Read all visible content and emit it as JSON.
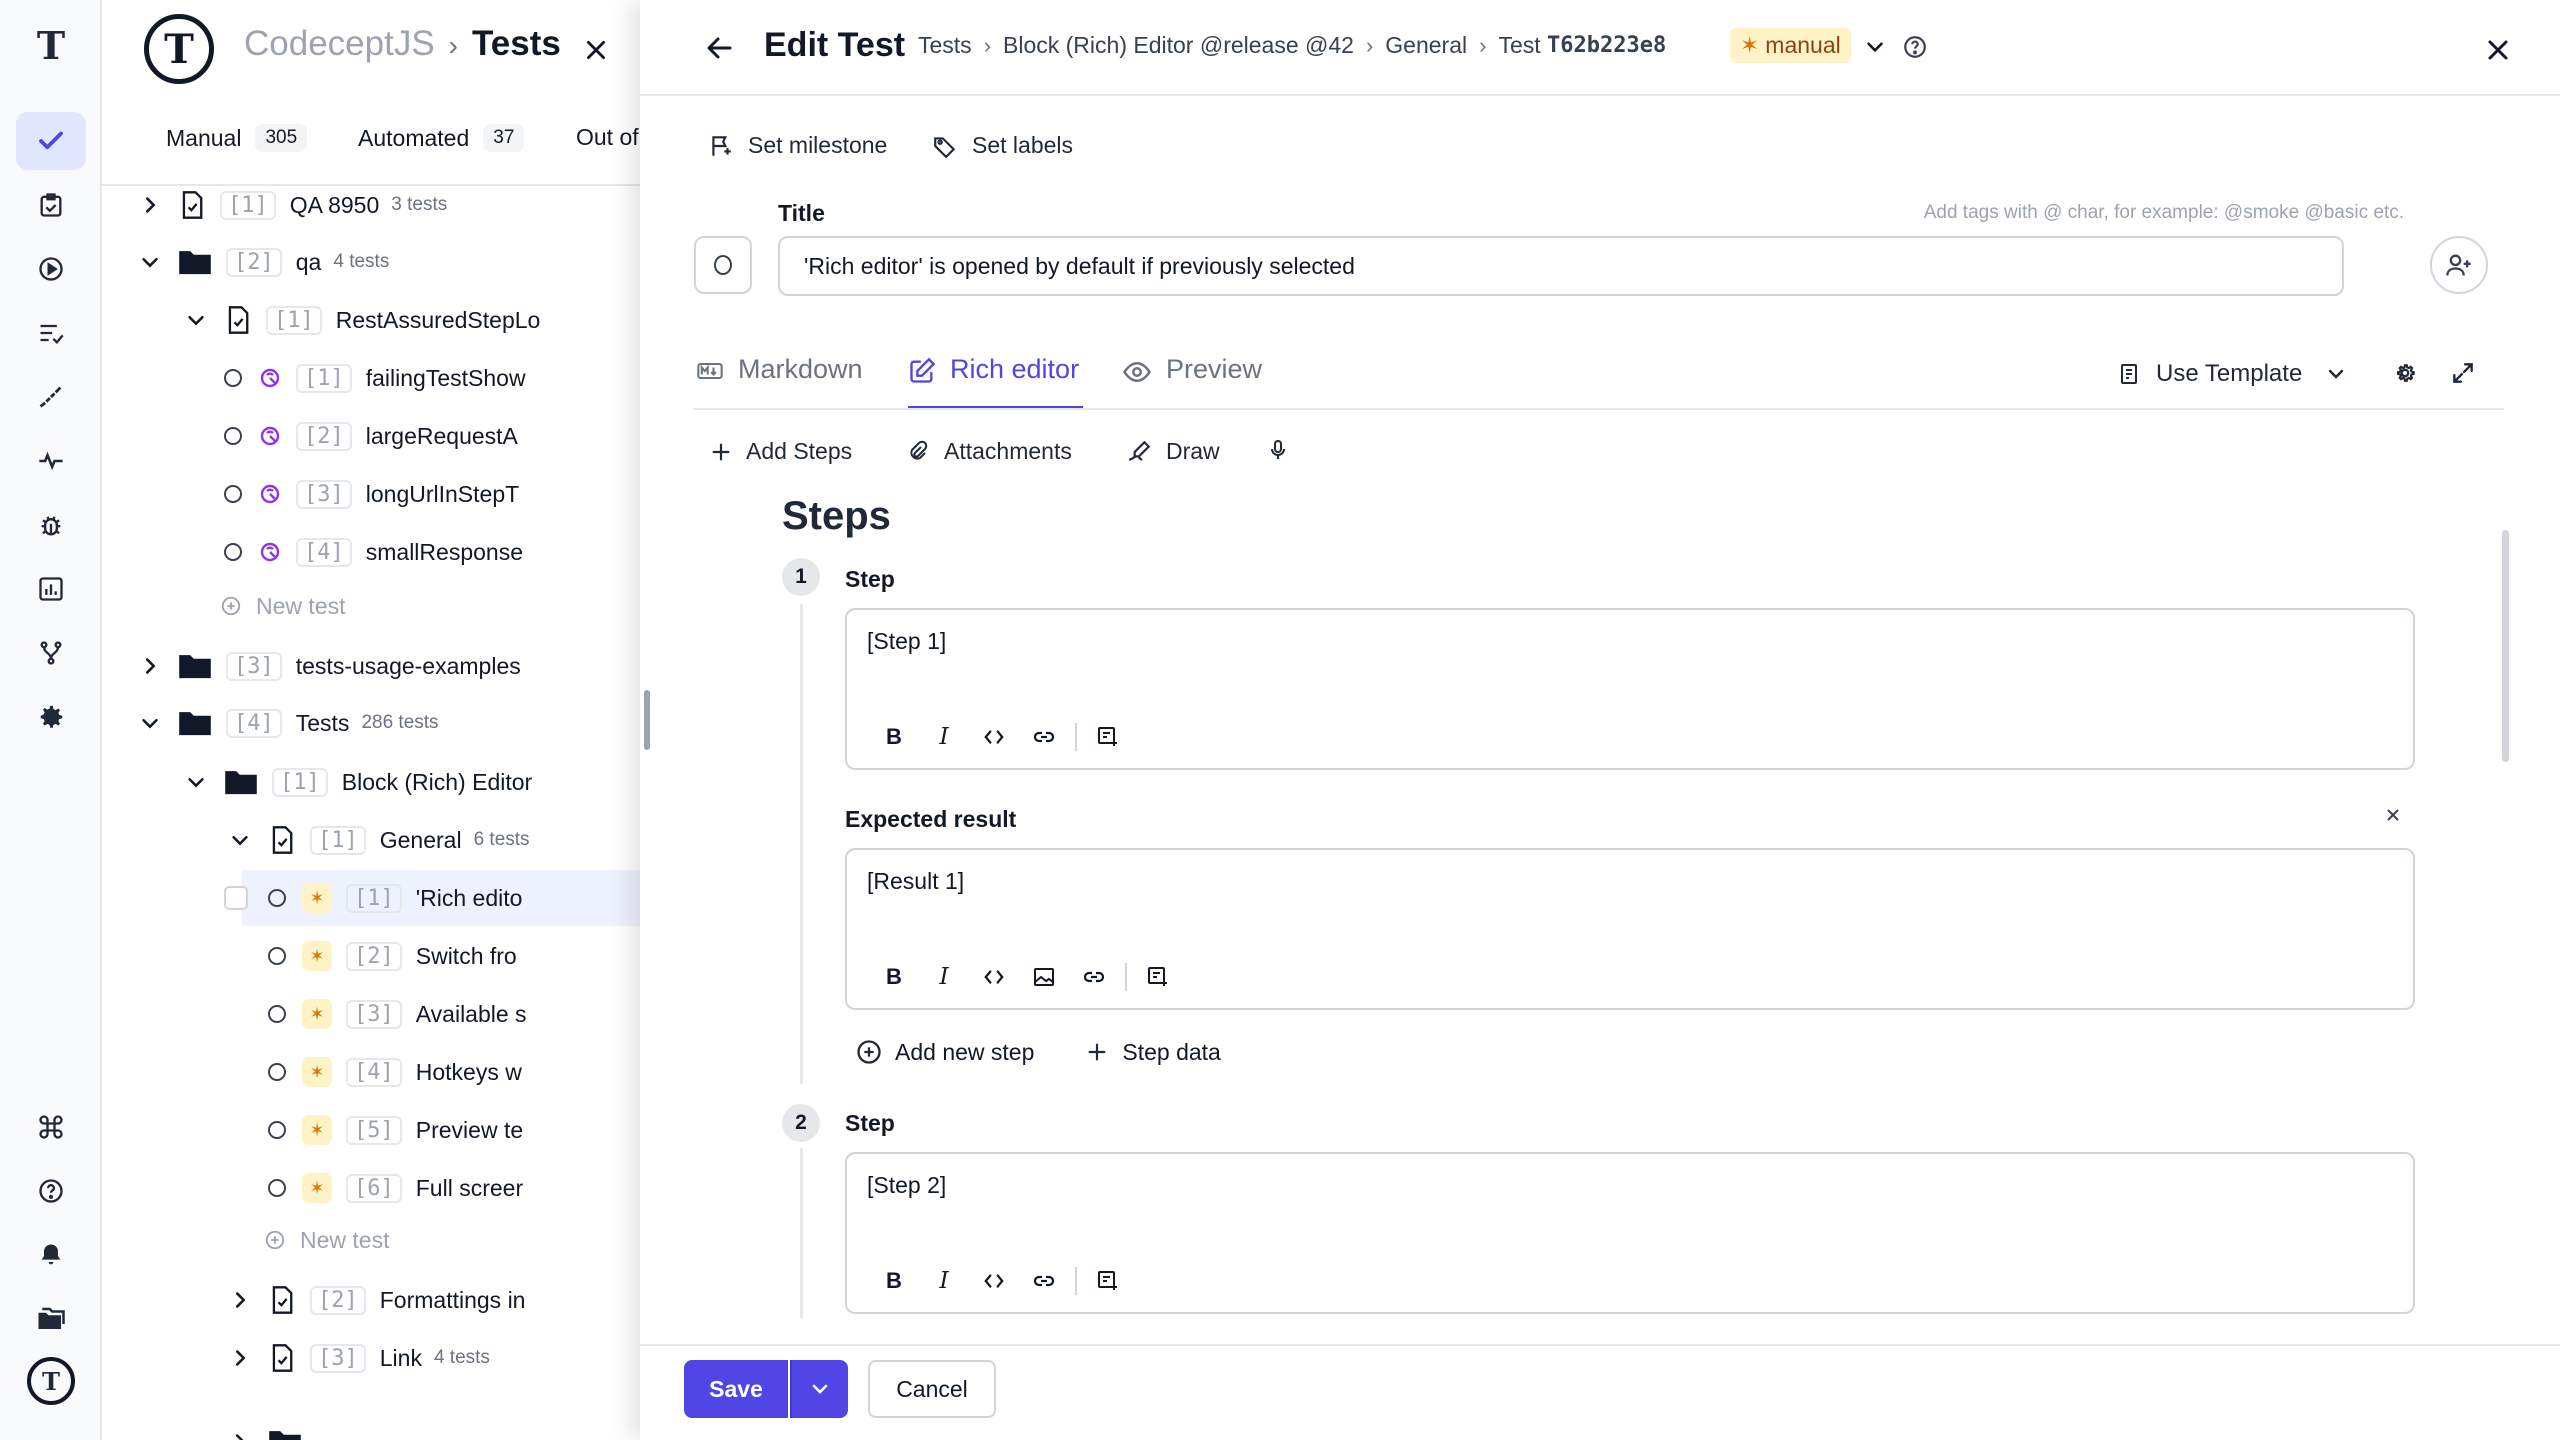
{
  "rail": {
    "icons": [
      "testomat-logo-icon",
      "checkmark-icon",
      "clipboard-check-icon",
      "play-circle-icon",
      "list-check-icon",
      "steps-icon",
      "pulse-icon",
      "bug-icon",
      "bar-chart-icon",
      "branch-icon",
      "gear-icon",
      "command-icon",
      "help-circle-icon",
      "bell-icon",
      "folders-icon",
      "testomat-avatar-icon"
    ]
  },
  "tree": {
    "project": "CodeceptJS",
    "section": "Tests",
    "tabs": [
      {
        "label": "Manual",
        "count": "305"
      },
      {
        "label": "Automated",
        "count": "37"
      },
      {
        "label": "Out of",
        "count": ""
      }
    ],
    "rows": [
      {
        "idx": "[1]",
        "name": "QA 8950",
        "sub": "3 tests"
      },
      {
        "idx": "[2]",
        "name": "qa",
        "sub": "4 tests"
      },
      {
        "idx": "[1]",
        "name": "RestAssuredStepLo",
        "sub": ""
      },
      {
        "idx": "[1]",
        "name": "failingTestShow",
        "sub": ""
      },
      {
        "idx": "[2]",
        "name": "largeRequestA",
        "sub": ""
      },
      {
        "idx": "[3]",
        "name": "longUrlInStepT",
        "sub": ""
      },
      {
        "idx": "[4]",
        "name": "smallResponse",
        "sub": ""
      },
      {
        "idx": "",
        "name": "New test",
        "sub": ""
      },
      {
        "idx": "[3]",
        "name": "tests-usage-examples",
        "sub": ""
      },
      {
        "idx": "[4]",
        "name": "Tests",
        "sub": "286 tests"
      },
      {
        "idx": "[1]",
        "name": "Block (Rich) Editor",
        "sub": ""
      },
      {
        "idx": "[1]",
        "name": "General",
        "sub": "6 tests"
      },
      {
        "idx": "[1]",
        "name": "'Rich edito",
        "sub": ""
      },
      {
        "idx": "[2]",
        "name": "Switch fro",
        "sub": ""
      },
      {
        "idx": "[3]",
        "name": "Available s",
        "sub": ""
      },
      {
        "idx": "[4]",
        "name": "Hotkeys w",
        "sub": ""
      },
      {
        "idx": "[5]",
        "name": "Preview te",
        "sub": ""
      },
      {
        "idx": "[6]",
        "name": "Full screer",
        "sub": ""
      },
      {
        "idx": "",
        "name": "New test",
        "sub": ""
      },
      {
        "idx": "[2]",
        "name": "Formattings in",
        "sub": ""
      },
      {
        "idx": "[3]",
        "name": "Link",
        "sub": "4 tests"
      }
    ]
  },
  "edit": {
    "heading": "Edit Test",
    "breadcrumbs": [
      "Tests",
      "Block (Rich) Editor @release @42",
      "General"
    ],
    "test_prefix": "Test",
    "test_id": "T62b223e8",
    "type_badge": "manual",
    "actions": {
      "milestone": "Set milestone",
      "labels": "Set labels"
    },
    "title_label": "Title",
    "tag_hint": "Add tags with @ char, for example: @smoke @basic etc.",
    "title_value": "'Rich editor' is opened by default if previously selected",
    "tabs": {
      "markdown": "Markdown",
      "rich": "Rich editor",
      "preview": "Preview"
    },
    "use_template": "Use Template",
    "tools": {
      "add_steps": "Add Steps",
      "attachments": "Attachments",
      "draw": "Draw"
    },
    "steps_heading": "Steps",
    "steps": [
      {
        "num": "1",
        "label": "Step",
        "text": "[Step 1]",
        "expected_label": "Expected result",
        "expected": "[Result 1]"
      },
      {
        "num": "2",
        "label": "Step",
        "text": "[Step 2]"
      }
    ],
    "add_new_step": "Add new step",
    "step_data": "Step data",
    "save": "Save",
    "cancel": "Cancel"
  },
  "colors": {
    "accent": "#4f46e5",
    "manual_bg": "#fef3c7",
    "manual_fg": "#92400e"
  }
}
